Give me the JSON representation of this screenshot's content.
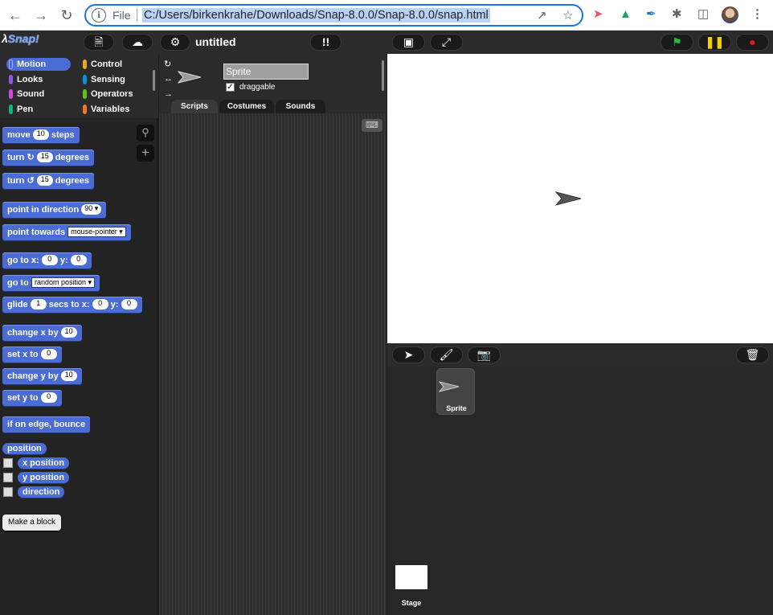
{
  "browser": {
    "file_label": "File",
    "url": "C:/Users/birkenkrahe/Downloads/Snap-8.0.0/Snap-8.0.0/snap.html"
  },
  "snap": {
    "logo": "Snap!",
    "project_title": "untitled",
    "categories": [
      {
        "label": "Motion",
        "color": "#4a6cd4"
      },
      {
        "label": "Looks",
        "color": "#8f56e3"
      },
      {
        "label": "Sound",
        "color": "#cf4ad9"
      },
      {
        "label": "Pen",
        "color": "#0fb47a"
      },
      {
        "label": "Control",
        "color": "#e6a822"
      },
      {
        "label": "Sensing",
        "color": "#0494dc"
      },
      {
        "label": "Operators",
        "color": "#62c213"
      },
      {
        "label": "Variables",
        "color": "#f3761d"
      }
    ],
    "blocks": {
      "move": {
        "pre": "move",
        "value": "10",
        "post": "steps"
      },
      "turn_cw": {
        "pre": "turn",
        "value": "15",
        "post": "degrees"
      },
      "turn_ccw": {
        "pre": "turn",
        "value": "15",
        "post": "degrees"
      },
      "point_dir": {
        "pre": "point in direction",
        "value": "90"
      },
      "point_towards": {
        "pre": "point towards",
        "value": "mouse-pointer"
      },
      "goto_xy": {
        "pre": "go to x:",
        "x": "0",
        "mid": "y:",
        "y": "0"
      },
      "goto": {
        "pre": "go to",
        "value": "random position"
      },
      "glide": {
        "pre": "glide",
        "secs": "1",
        "mid": "secs to x:",
        "x": "0",
        "mid2": "y:",
        "y": "0"
      },
      "change_x": {
        "pre": "change x by",
        "value": "10"
      },
      "set_x": {
        "pre": "set x to",
        "value": "0"
      },
      "change_y": {
        "pre": "change y by",
        "value": "10"
      },
      "set_y": {
        "pre": "set y to",
        "value": "0"
      },
      "bounce": {
        "label": "if on edge, bounce"
      },
      "position": {
        "label": "position"
      },
      "x_position": {
        "label": "x position"
      },
      "y_position": {
        "label": "y position"
      },
      "direction": {
        "label": "direction"
      }
    },
    "make_block": "Make a block",
    "sprite_name": "Sprite",
    "draggable_label": "draggable",
    "tabs": [
      "Scripts",
      "Costumes",
      "Sounds"
    ],
    "corral": {
      "sprite_label": "Sprite",
      "stage_label": "Stage"
    }
  }
}
